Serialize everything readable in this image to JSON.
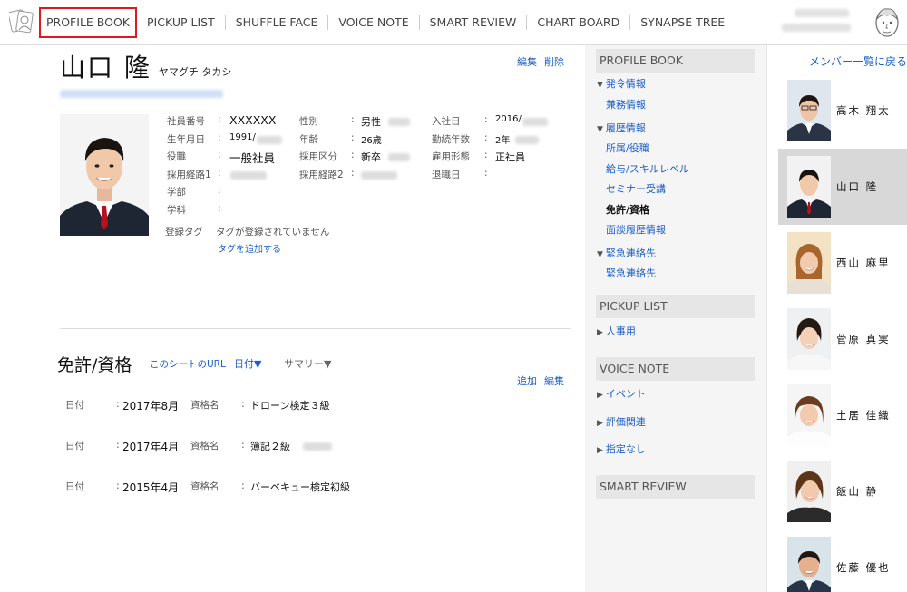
{
  "nav": {
    "items": [
      "PROFILE BOOK",
      "PICKUP LIST",
      "SHUFFLE FACE",
      "VOICE NOTE",
      "SMART REVIEW",
      "CHART BOARD",
      "SYNAPSE TREE"
    ],
    "active_index": 0,
    "highlight_color": "#e0191f"
  },
  "profile": {
    "name": "山口 隆",
    "kana": "ヤマグチ タカシ",
    "edit_label": "編集",
    "delete_label": "削除",
    "fields": {
      "employee_no_label": "社員番号",
      "employee_no": "XXXXXX",
      "birth_label": "生年月日",
      "birth": "1991/",
      "position_label": "役職",
      "position": "一般社員",
      "route1_label": "採用経路1",
      "faculty_label": "学部",
      "major_label": "学科",
      "gender_label": "性別",
      "gender": "男性",
      "age_label": "年齢",
      "age": "26歳",
      "hire_type_label": "採用区分",
      "hire_type": "新卒",
      "route2_label": "採用経路2",
      "join_label": "入社日",
      "join": "2016/",
      "tenure_label": "勤続年数",
      "tenure": "2年",
      "employment_label": "雇用形態",
      "employment": "正社員",
      "retire_label": "退職日",
      "colon": ":"
    },
    "tag_label": "登録タグ",
    "tag_empty": "タグが登録されていません",
    "tag_add": "タグを追加する"
  },
  "license": {
    "title": "免許/資格",
    "sheet_url": "このシートのURL",
    "date_sort": "日付▼",
    "summary": "サマリー▼",
    "add_label": "追加",
    "edit_label": "編集",
    "date_label": "日付",
    "name_label": "資格名",
    "rows": [
      {
        "date": "2017年8月",
        "name": "ドローン検定３級"
      },
      {
        "date": "2017年4月",
        "name": "簿記２級"
      },
      {
        "date": "2015年4月",
        "name": "バーベキュー検定初級"
      }
    ]
  },
  "side": {
    "profile_head": "PROFILE BOOK",
    "group1": "発令情報",
    "g1_item1": "兼務情報",
    "group2": "履歴情報",
    "g2_items": [
      "所属/役職",
      "給与/スキルレベル",
      "セミナー受講",
      "免許/資格",
      "面談履歴情報"
    ],
    "group3": "緊急連絡先",
    "g3_item1": "緊急連絡先",
    "pickup_head": "PICKUP LIST",
    "pickup_item": "人事用",
    "voice_head": "VOICE NOTE",
    "voice_items": [
      "イベント",
      "評価関連",
      "指定なし"
    ],
    "review_head": "SMART REVIEW",
    "current_item": "免許/資格"
  },
  "members": {
    "back_label": "メンバー一覧に戻る",
    "list": [
      "高木 翔太",
      "山口 隆",
      "西山 麻里",
      "菅原 真実",
      "土居 佳織",
      "飯山 静",
      "佐藤 優也"
    ],
    "selected_index": 1
  },
  "colors": {
    "link": "#1b5fc6",
    "side_bg": "#f5f5f5",
    "side_head": "#e6e6e6",
    "selected": "#d8d8d8"
  }
}
